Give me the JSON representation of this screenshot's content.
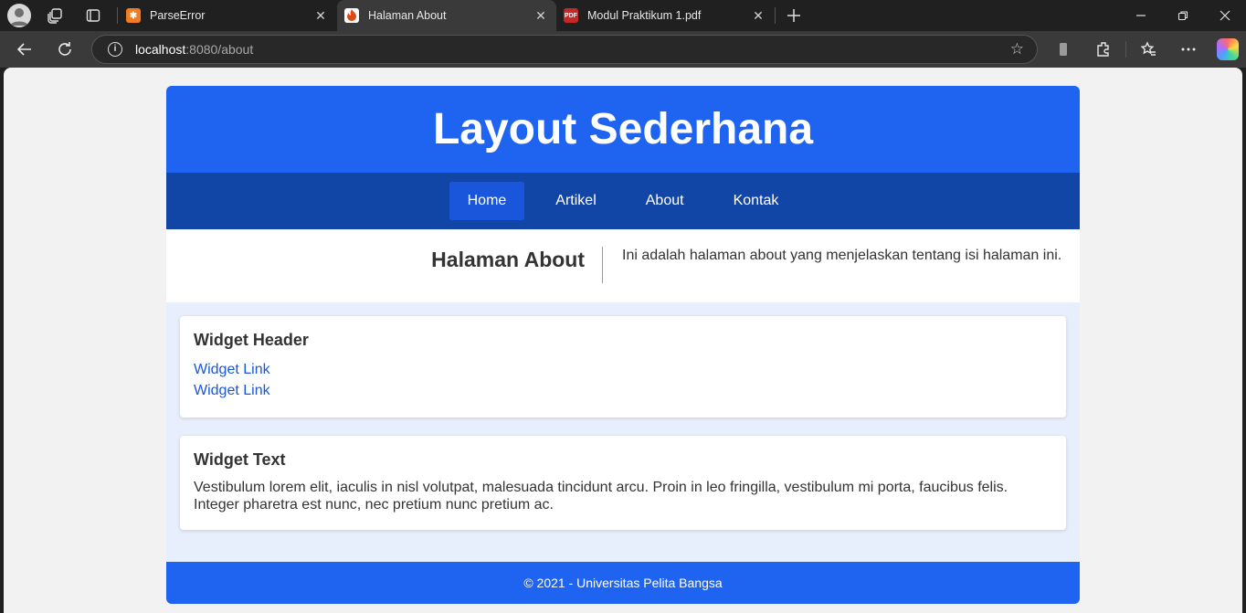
{
  "browser": {
    "tabs": [
      {
        "title": "ParseError",
        "favicon": "xampp-icon",
        "active": false
      },
      {
        "title": "Halaman About",
        "favicon": "codeigniter-icon",
        "active": true
      },
      {
        "title": "Modul Praktikum 1.pdf",
        "favicon": "pdf-icon",
        "active": false
      }
    ],
    "url_host": "localhost",
    "url_rest": ":8080/about",
    "colors": {
      "chrome": "#202020",
      "toolbar": "#3a3a3a"
    }
  },
  "page": {
    "header_title": "Layout Sederhana",
    "nav": [
      "Home",
      "Artikel",
      "About",
      "Kontak"
    ],
    "nav_active": "Home",
    "hero_title": "Halaman About",
    "hero_text": "Ini adalah halaman about yang menjelaskan tentang isi halaman ini.",
    "widget1": {
      "title": "Widget Header",
      "links": [
        "Widget Link",
        "Widget Link"
      ]
    },
    "widget2": {
      "title": "Widget Text",
      "text": "Vestibulum lorem elit, iaculis in nisl volutpat, malesuada tincidunt arcu. Proin in leo fringilla, vestibulum mi porta, faucibus felis. Integer pharetra est nunc, nec pretium nunc pretium ac."
    },
    "footer": "© 2021 - Universitas Pelita Bangsa",
    "colors": {
      "primary": "#1f64f1",
      "nav": "#1246a6",
      "link": "#1a56db",
      "widget_bg": "#e8effc"
    }
  }
}
